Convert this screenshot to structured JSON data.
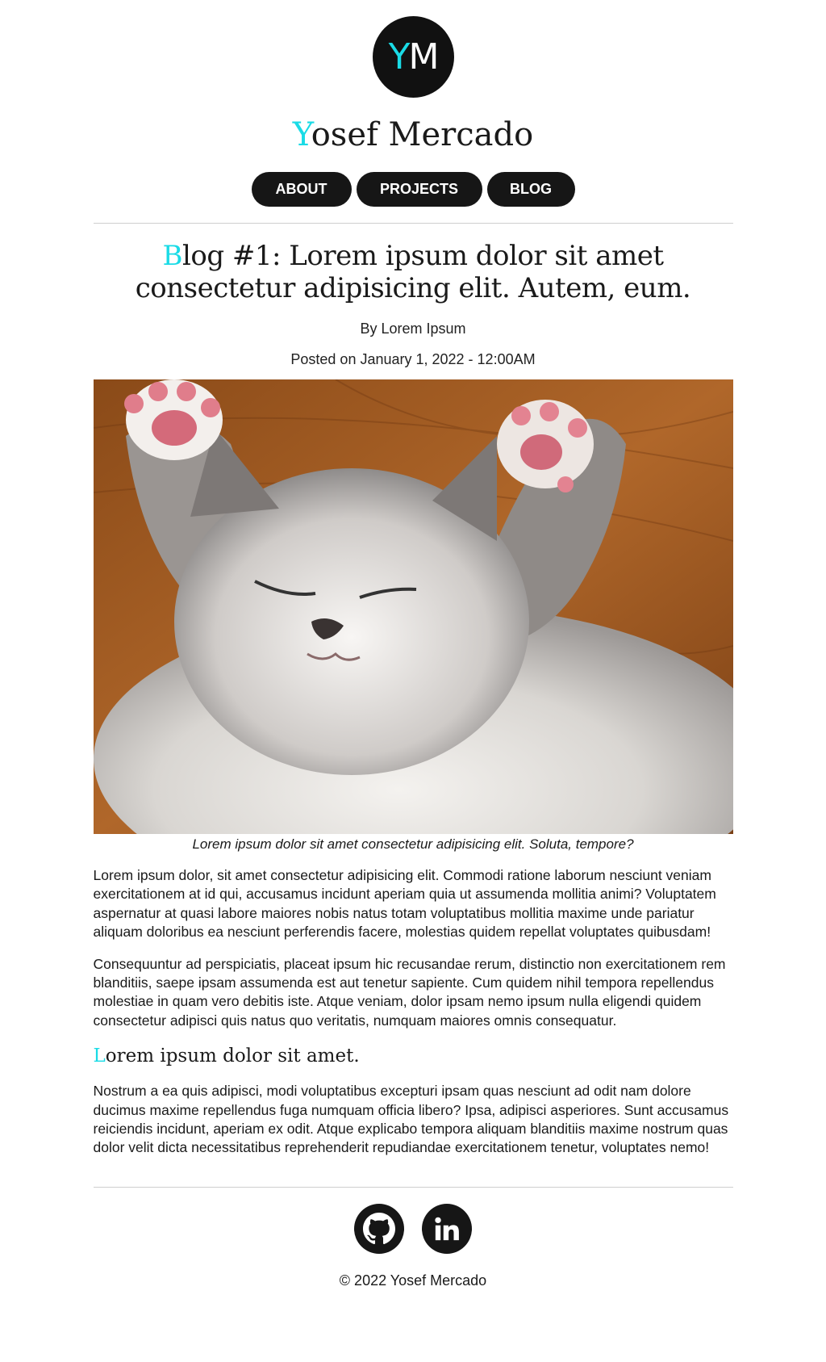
{
  "header": {
    "logo": {
      "first": "Y",
      "rest": "M"
    },
    "site_name": {
      "first": "Y",
      "rest": "osef Mercado"
    },
    "accent_color": "#1adbe6"
  },
  "nav": {
    "items": [
      {
        "label": "ABOUT"
      },
      {
        "label": "PROJECTS"
      },
      {
        "label": "BLOG"
      }
    ]
  },
  "post": {
    "title": {
      "first": "B",
      "line1": "log #1: Lorem ipsum dolor sit amet",
      "line2": "consectetur adipisicing elit. Autem, eum."
    },
    "author": "By Lorem Ipsum",
    "date": "Posted on January 1, 2022 - 12:00AM",
    "image_caption": "Lorem ipsum dolor sit amet consectetur adipisicing elit. Soluta, tempore?",
    "paragraphs": [
      "Lorem ipsum dolor, sit amet consectetur adipisicing elit. Commodi ratione laborum nesciunt veniam exercitationem at id qui, accusamus incidunt aperiam quia ut assumenda mollitia animi? Voluptatem aspernatur at quasi labore maiores nobis natus totam voluptatibus mollitia maxime unde pariatur aliquam doloribus ea nesciunt perferendis facere, molestias quidem repellat voluptates quibusdam!",
      "Consequuntur ad perspiciatis, placeat ipsum hic recusandae rerum, distinctio non exercitationem rem blanditiis, saepe ipsam assumenda est aut tenetur sapiente. Cum quidem nihil tempora repellendus molestiae in quam vero debitis iste. Atque veniam, dolor ipsam nemo ipsum nulla eligendi quidem consectetur adipisci quis natus quo veritatis, numquam maiores omnis consequatur."
    ],
    "subheading": {
      "first": "L",
      "rest": "orem ipsum dolor sit amet."
    },
    "paragraph_after_subheading": "Nostrum a ea quis adipisci, modi voluptatibus excepturi ipsam quas nesciunt ad odit nam dolore ducimus maxime repellendus fuga numquam officia libero? Ipsa, adipisci asperiores. Sunt accusamus reiciendis incidunt, aperiam ex odit. Atque explicabo tempora aliquam blanditiis maxime nostrum quas dolor velit dicta necessitatibus reprehenderit repudiandae exercitationem tenetur, voluptates nemo!"
  },
  "footer": {
    "social": [
      {
        "icon": "github-icon"
      },
      {
        "icon": "linkedin-icon"
      }
    ],
    "copyright": "© 2022 Yosef Mercado"
  }
}
